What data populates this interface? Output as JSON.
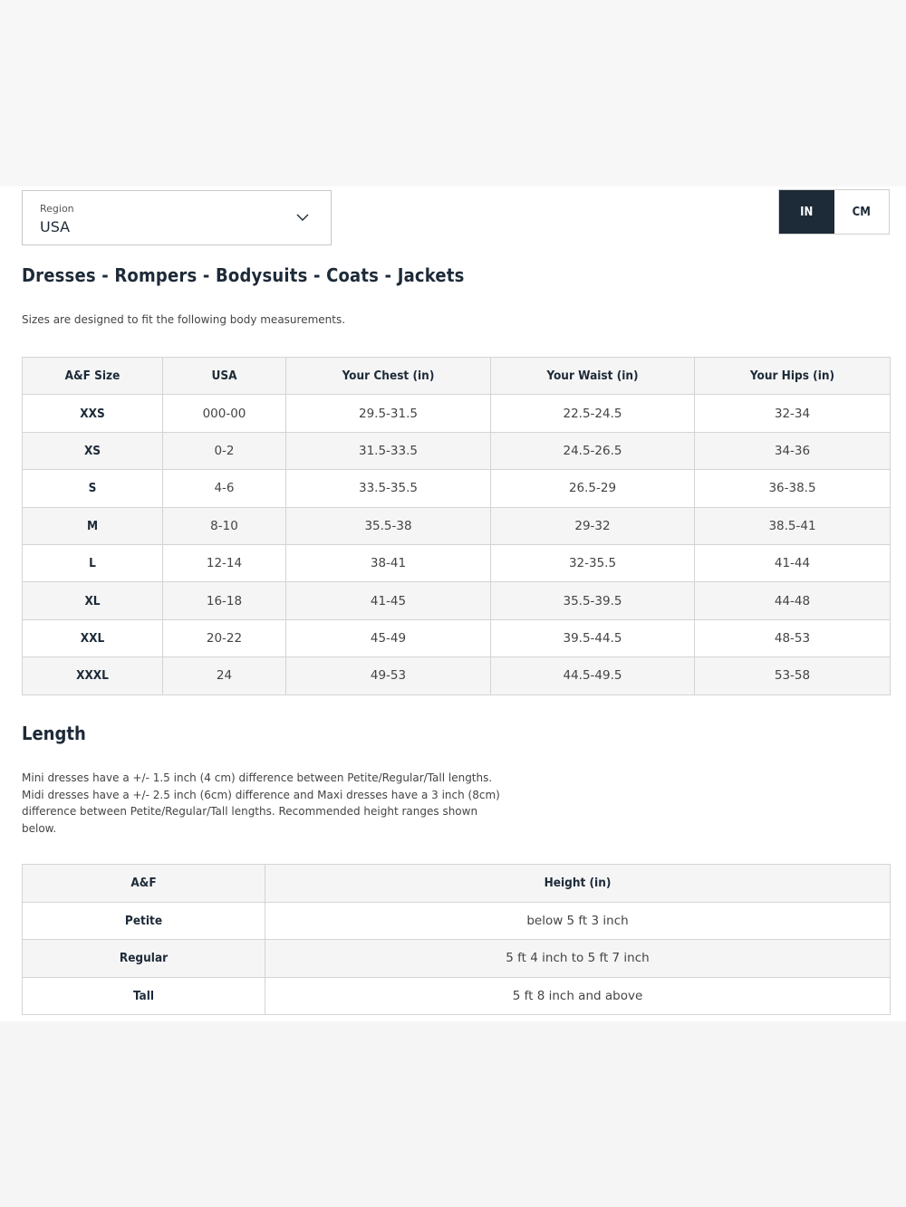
{
  "region": {
    "label": "Region",
    "value": "USA"
  },
  "units": {
    "in_label": "IN",
    "cm_label": "CM",
    "active": "IN"
  },
  "size_section": {
    "title": "Dresses - Rompers - Bodysuits - Coats - Jackets",
    "description": "Sizes are designed to fit the following body measurements.",
    "headers": [
      "A&F Size",
      "USA",
      "Your Chest (in)",
      "Your Waist (in)",
      "Your Hips (in)"
    ],
    "rows": [
      [
        "XXS",
        "000-00",
        "29.5-31.5",
        "22.5-24.5",
        "32-34"
      ],
      [
        "XS",
        "0-2",
        "31.5-33.5",
        "24.5-26.5",
        "34-36"
      ],
      [
        "S",
        "4-6",
        "33.5-35.5",
        "26.5-29",
        "36-38.5"
      ],
      [
        "M",
        "8-10",
        "35.5-38",
        "29-32",
        "38.5-41"
      ],
      [
        "L",
        "12-14",
        "38-41",
        "32-35.5",
        "41-44"
      ],
      [
        "XL",
        "16-18",
        "41-45",
        "35.5-39.5",
        "44-48"
      ],
      [
        "XXL",
        "20-22",
        "45-49",
        "39.5-44.5",
        "48-53"
      ],
      [
        "XXXL",
        "24",
        "49-53",
        "44.5-49.5",
        "53-58"
      ]
    ]
  },
  "length_section": {
    "title": "Length",
    "description_lines": [
      "Mini dresses have a +/- 1.5 inch (4 cm) difference between Petite/Regular/Tall lengths.",
      "Midi dresses have a +/- 2.5 inch (6cm) difference and Maxi dresses have a 3 inch (8cm)",
      "difference between Petite/Regular/Tall lengths. Recommended height ranges shown",
      "below."
    ],
    "headers": [
      "A&F",
      "Height (in)"
    ],
    "rows": [
      [
        "Petite",
        "below 5 ft 3 inch"
      ],
      [
        "Regular",
        "5 ft 4 inch to 5 ft 7 inch"
      ],
      [
        "Tall",
        "5 ft 8 inch and above"
      ]
    ]
  },
  "colors": {
    "navy": "#1d2a38",
    "row_shade": "#f5f5f5",
    "border": "#d4d4d4"
  },
  "icons": {
    "region_dropdown": "chevron-down-icon"
  }
}
